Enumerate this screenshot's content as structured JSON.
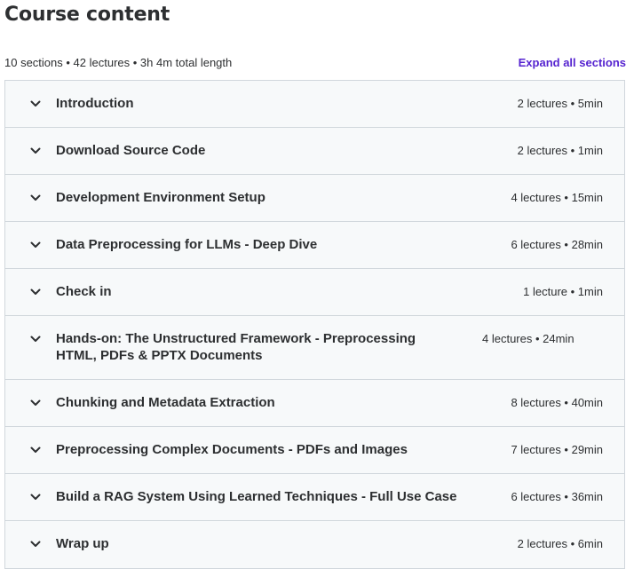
{
  "header": {
    "title": "Course content",
    "summary": "10 sections • 42 lectures • 3h 4m total length",
    "expand_label": "Expand all sections"
  },
  "sections": [
    {
      "title": "Introduction",
      "meta": "2 lectures • 5min"
    },
    {
      "title": "Download Source Code",
      "meta": "2 lectures • 1min"
    },
    {
      "title": "Development Environment Setup",
      "meta": "4 lectures • 15min"
    },
    {
      "title": "Data Preprocessing for LLMs - Deep Dive",
      "meta": "6 lectures • 28min"
    },
    {
      "title": "Check in",
      "meta": "1 lecture • 1min"
    },
    {
      "title": "Hands-on: The Unstructured Framework - Preprocessing HTML, PDFs & PPTX Documents",
      "meta": "4 lectures • 24min"
    },
    {
      "title": "Chunking and Metadata Extraction",
      "meta": "8 lectures • 40min"
    },
    {
      "title": "Preprocessing Complex Documents - PDFs and Images",
      "meta": "7 lectures • 29min"
    },
    {
      "title": "Build a RAG System Using Learned Techniques - Full Use Case",
      "meta": "6 lectures • 36min"
    },
    {
      "title": "Wrap up",
      "meta": "2 lectures • 6min"
    }
  ],
  "icons": {
    "section_toggle": "chevron-down-icon"
  },
  "colors": {
    "accent": "#5624d0",
    "text": "#2d2f31",
    "section_bg": "#f7f9fa",
    "border": "#d1d7dc"
  }
}
